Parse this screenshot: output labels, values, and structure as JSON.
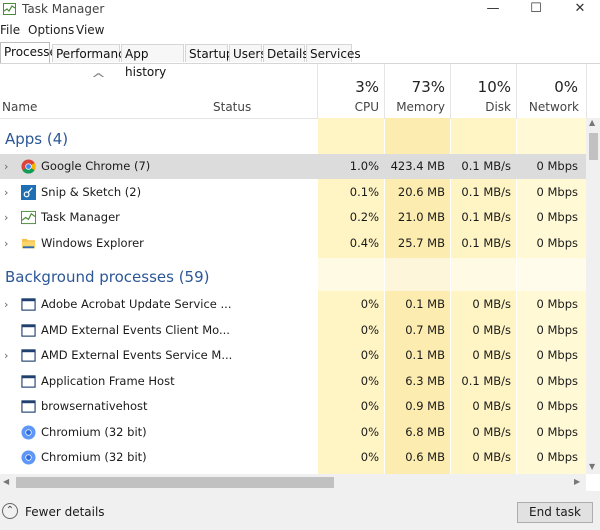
{
  "window": {
    "title": "Task Manager",
    "minimize": "—",
    "maximize": "☐",
    "close": "✕"
  },
  "menu": [
    "File",
    "Options",
    "View"
  ],
  "tabs": [
    "Processes",
    "Performance",
    "App history",
    "Startup",
    "Users",
    "Details",
    "Services"
  ],
  "header": {
    "sort_arrow": "^",
    "name": "Name",
    "status": "Status",
    "cpu_pct": "3%",
    "cpu": "CPU",
    "mem_pct": "73%",
    "mem": "Memory",
    "disk_pct": "10%",
    "disk": "Disk",
    "net_pct": "0%",
    "net": "Network"
  },
  "groups": {
    "apps": "Apps (4)",
    "background": "Background processes (59)"
  },
  "apps": [
    {
      "name": "Google Chrome (7)",
      "cpu": "1.0%",
      "memory": "423.4 MB",
      "disk": "0.1 MB/s",
      "network": "0 Mbps",
      "icon": "chrome-icon",
      "expandable": true,
      "selected": true
    },
    {
      "name": "Snip & Sketch (2)",
      "cpu": "0.1%",
      "memory": "20.6 MB",
      "disk": "0.1 MB/s",
      "network": "0 Mbps",
      "icon": "snip-sketch-icon",
      "expandable": true
    },
    {
      "name": "Task Manager",
      "cpu": "0.2%",
      "memory": "21.0 MB",
      "disk": "0.1 MB/s",
      "network": "0 Mbps",
      "icon": "task-manager-icon",
      "expandable": true
    },
    {
      "name": "Windows Explorer",
      "cpu": "0.4%",
      "memory": "25.7 MB",
      "disk": "0.1 MB/s",
      "network": "0 Mbps",
      "icon": "folder-icon",
      "expandable": true
    }
  ],
  "background": [
    {
      "name": "Adobe Acrobat Update Service ...",
      "cpu": "0%",
      "memory": "0.1 MB",
      "disk": "0 MB/s",
      "network": "0 Mbps",
      "icon": "window-icon",
      "expandable": true
    },
    {
      "name": "AMD External Events Client Mo...",
      "cpu": "0%",
      "memory": "0.7 MB",
      "disk": "0 MB/s",
      "network": "0 Mbps",
      "icon": "window-icon",
      "expandable": false
    },
    {
      "name": "AMD External Events Service M...",
      "cpu": "0%",
      "memory": "0.1 MB",
      "disk": "0 MB/s",
      "network": "0 Mbps",
      "icon": "window-icon",
      "expandable": true
    },
    {
      "name": "Application Frame Host",
      "cpu": "0%",
      "memory": "6.3 MB",
      "disk": "0.1 MB/s",
      "network": "0 Mbps",
      "icon": "window-icon",
      "expandable": false
    },
    {
      "name": "browsernativehost",
      "cpu": "0%",
      "memory": "0.9 MB",
      "disk": "0 MB/s",
      "network": "0 Mbps",
      "icon": "window-icon",
      "expandable": false
    },
    {
      "name": "Chromium (32 bit)",
      "cpu": "0%",
      "memory": "6.8 MB",
      "disk": "0 MB/s",
      "network": "0 Mbps",
      "icon": "chromium-icon",
      "expandable": false
    },
    {
      "name": "Chromium (32 bit)",
      "cpu": "0%",
      "memory": "0.6 MB",
      "disk": "0 MB/s",
      "network": "0 Mbps",
      "icon": "chromium-icon",
      "expandable": false
    }
  ],
  "footer": {
    "fewer_details": "Fewer details",
    "end_task": "End task"
  },
  "colors": {
    "group_title": "#2b5797",
    "heat_light": "#fff9d6",
    "heat_medium": "#fff4c4",
    "heat_memory": "#fcecb0",
    "selected_row": "#dcdcdc"
  }
}
